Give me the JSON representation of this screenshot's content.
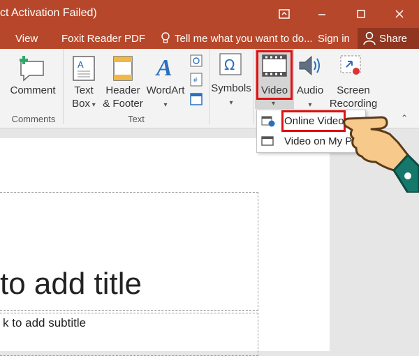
{
  "titlebar": {
    "title": "ct Activation Failed)",
    "bg": "#b7472a"
  },
  "menu": {
    "items": [
      "View",
      "Foxit Reader PDF"
    ],
    "tell_me": "Tell me what you want to do...",
    "sign_in": "Sign in",
    "share": "Share"
  },
  "ribbon": {
    "comment": "Comment",
    "text_box_1": "Text",
    "text_box_2": "Box",
    "header_1": "Header",
    "header_2": "& Footer",
    "wordart": "WordArt",
    "symbols": "Symbols",
    "video": "Video",
    "audio": "Audio",
    "screen_1": "Screen",
    "screen_2": "Recording",
    "groups": {
      "comments": "Comments",
      "text": "Text"
    }
  },
  "dropdown": {
    "online_video": "Online Video...",
    "video_on_pc": "Video on My PC..."
  },
  "slide": {
    "title_placeholder": "to add title",
    "subtitle_placeholder": "k to add subtitle"
  },
  "colors": {
    "accent": "#b7472a",
    "highlight": "#e01010"
  }
}
